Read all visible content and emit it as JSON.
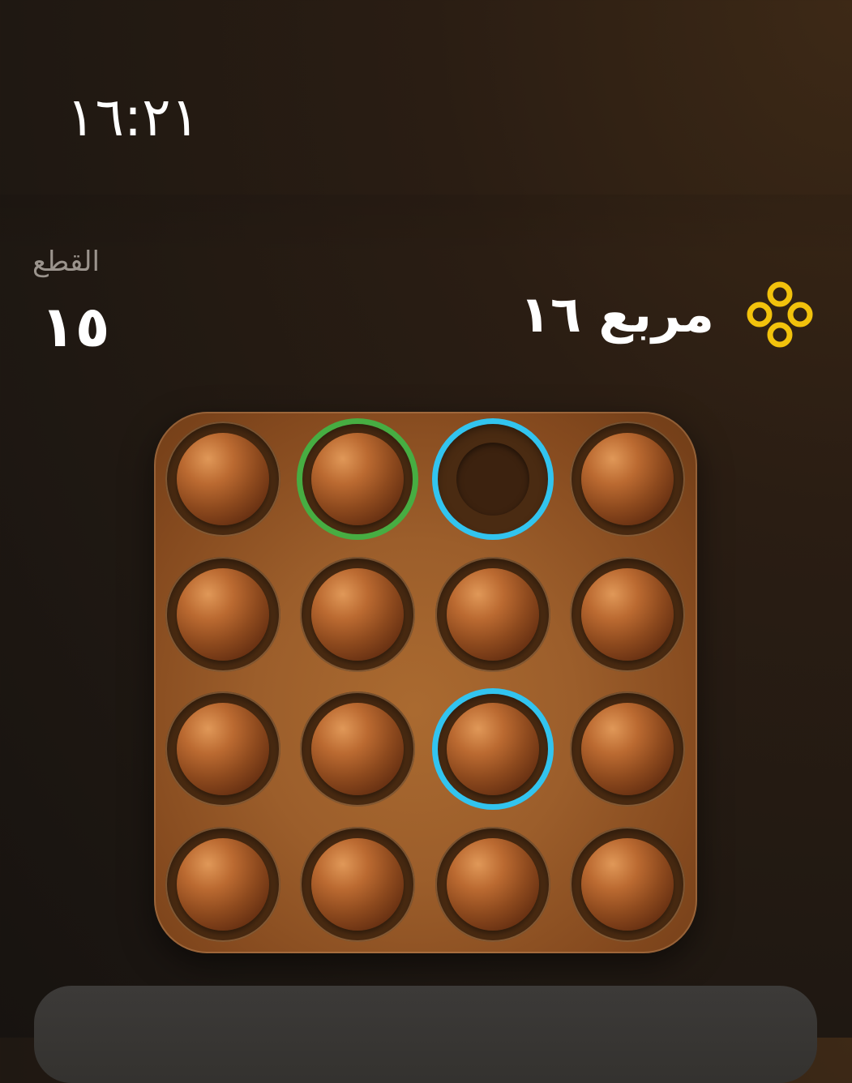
{
  "status": {
    "clock": "١٦:٢١"
  },
  "stats": {
    "pieces_label": "القطع",
    "pieces_count": "١٥"
  },
  "level": {
    "icon": "four-circles-icon",
    "name": "مربع ١٦",
    "icon_color": "#f2c20c"
  },
  "board": {
    "rows": 4,
    "cols": 4,
    "cells": [
      [
        {
          "peg": true,
          "highlight": "none"
        },
        {
          "peg": true,
          "highlight": "green"
        },
        {
          "peg": false,
          "highlight": "blue"
        },
        {
          "peg": true,
          "highlight": "none"
        }
      ],
      [
        {
          "peg": true,
          "highlight": "none"
        },
        {
          "peg": true,
          "highlight": "none"
        },
        {
          "peg": true,
          "highlight": "none"
        },
        {
          "peg": true,
          "highlight": "none"
        }
      ],
      [
        {
          "peg": true,
          "highlight": "none"
        },
        {
          "peg": true,
          "highlight": "none"
        },
        {
          "peg": true,
          "highlight": "blue"
        },
        {
          "peg": true,
          "highlight": "none"
        }
      ],
      [
        {
          "peg": true,
          "highlight": "none"
        },
        {
          "peg": true,
          "highlight": "none"
        },
        {
          "peg": true,
          "highlight": "none"
        },
        {
          "peg": true,
          "highlight": "none"
        }
      ]
    ],
    "colors": {
      "selected": "#47ad42",
      "target": "#32c4ef"
    }
  },
  "message": {
    "text": ""
  }
}
